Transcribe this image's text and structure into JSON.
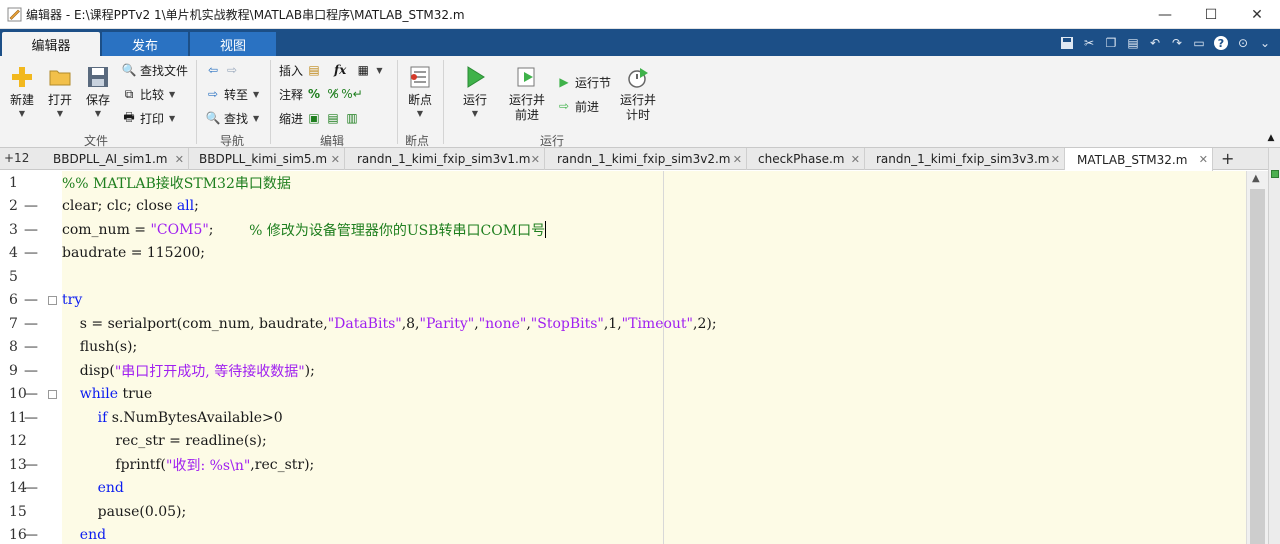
{
  "window": {
    "title": "编辑器 - E:\\课程PPTv2 1\\单片机实战教程\\MATLAB串口程序\\MATLAB_STM32.m",
    "minimize": "—",
    "maximize": "☐",
    "close": "✕"
  },
  "ribbon_tabs": [
    "编辑器",
    "发布",
    "视图"
  ],
  "ribbon": {
    "file": {
      "group": "文件",
      "new": "新建",
      "open": "打开",
      "save": "保存",
      "find_files": "查找文件",
      "compare": "比较",
      "print": "打印"
    },
    "navigate": {
      "group": "导航",
      "goto": "转至",
      "find": "查找"
    },
    "edit": {
      "group": "编辑",
      "insert": "插入",
      "comment": "注释",
      "indent": "缩进",
      "fx": "fx"
    },
    "breakpoints": {
      "group": "断点",
      "breakpoints": "断点"
    },
    "run": {
      "group": "运行",
      "run": "运行",
      "run_advance": "运行并\n前进",
      "run_section": "运行节",
      "advance": "前进",
      "run_time": "运行并\n计时"
    }
  },
  "editor_tabs": {
    "more": "+12",
    "tabs": [
      {
        "name": "BBDPLL_AI_sim1.m"
      },
      {
        "name": "BBDPLL_kimi_sim5.m"
      },
      {
        "name": "randn_1_kimi_fxip_sim3v1.m"
      },
      {
        "name": "randn_1_kimi_fxip_sim3v2.m"
      },
      {
        "name": "checkPhase.m"
      },
      {
        "name": "randn_1_kimi_fxip_sim3v3.m"
      },
      {
        "name": "MATLAB_STM32.m"
      }
    ],
    "close_glyph": "✕",
    "add": "+"
  },
  "code": {
    "line_numbers": [
      "1",
      "2",
      "3",
      "4",
      "5",
      "6",
      "7",
      "8",
      "9",
      "10",
      "11",
      "12",
      "13",
      "14",
      "15",
      "16"
    ],
    "l1": "%% MATLAB接收STM32串口数据",
    "l2": "clear; clc; close ",
    "l2_kw": "all",
    "l2_end": ";",
    "l3a": "com_num = ",
    "l3_str": "\"COM5\"",
    "l3b": ";        ",
    "l3_cmt": "% 修改为设备管理器你的USB转串口COM口号",
    "l4": "baudrate = 115200;",
    "l6": "try",
    "l7a": "    s = serialport(com_num, baudrate,",
    "l7s1": "\"DataBits\"",
    "l7b": ",8,",
    "l7s2": "\"Parity\"",
    "l7c": ",",
    "l7s3": "\"none\"",
    "l7d": ",",
    "l7s4": "\"StopBits\"",
    "l7e": ",1,",
    "l7s5": "\"Timeout\"",
    "l7f": ",2);",
    "l8": "    flush(s);",
    "l9a": "    disp(",
    "l9s": "\"串口打开成功, 等待接收数据\"",
    "l9b": ");",
    "l10_kw": "    while",
    "l10": " true",
    "l11_kw": "        if",
    "l11": " s.NumBytesAvailable>0",
    "l12": "            rec_str = readline(s);",
    "l13a": "            fprintf(",
    "l13s": "\"收到: %s\\n\"",
    "l13b": ",rec_str);",
    "l14_kw": "        end",
    "l15": "        pause(0.05);",
    "l16_kw": "    end"
  },
  "colors": {
    "ribbon_blue": "#1c4f87",
    "tab_blue": "#2a72c2",
    "code_background": "#fdfbe6",
    "keyword": "#0b1cf0",
    "string": "#a020f0",
    "comment": "#1f7f1f"
  }
}
